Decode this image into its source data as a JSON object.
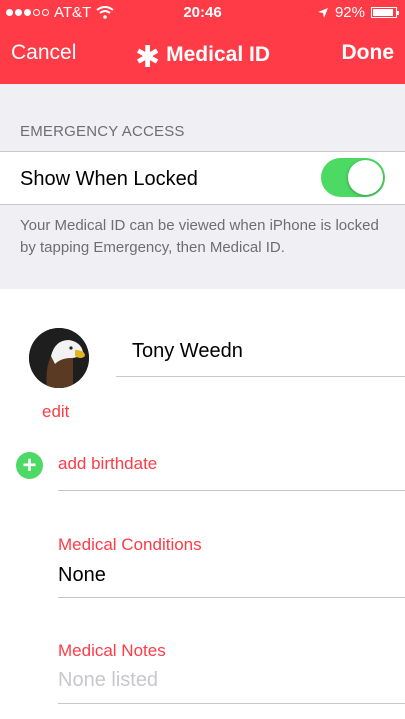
{
  "status_bar": {
    "carrier": "AT&T",
    "time": "20:46",
    "battery_percent": "92%",
    "battery_level": 0.92,
    "signal_bars_filled": 3,
    "signal_bars_total": 5
  },
  "nav": {
    "cancel_label": "Cancel",
    "title": "Medical ID",
    "title_icon": "asterisk-icon",
    "done_label": "Done"
  },
  "emergency": {
    "section_header": "EMERGENCY ACCESS",
    "show_when_locked_label": "Show When Locked",
    "show_when_locked_on": true,
    "footer": "Your Medical ID can be viewed when iPhone is locked by tapping Emergency, then Medical ID."
  },
  "profile": {
    "name": "Tony Weedn",
    "edit_label": "edit",
    "avatar_icon": "eagle-avatar"
  },
  "fields": {
    "add_birthdate_label": "add birthdate",
    "medical_conditions_label": "Medical Conditions",
    "medical_conditions_value": "None",
    "medical_notes_label": "Medical Notes",
    "medical_notes_placeholder": "None listed"
  },
  "colors": {
    "accent_red": "#fe3b47",
    "toggle_green": "#4cd964",
    "group_bg": "#efeff4"
  }
}
